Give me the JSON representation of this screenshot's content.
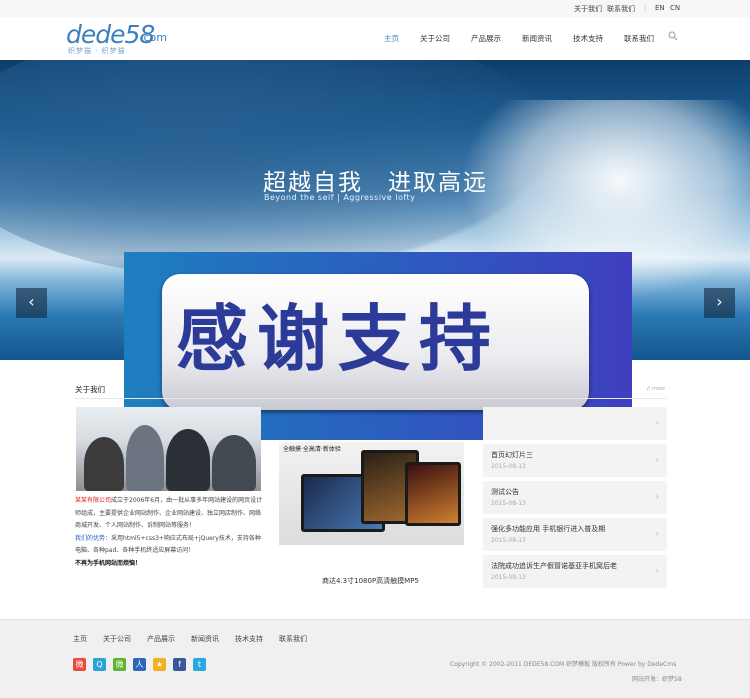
{
  "topbar": {
    "links": [
      "关于我们",
      "联系我们"
    ],
    "sep": "|",
    "lang_en": "EN",
    "lang_cn": "CN"
  },
  "logo": {
    "main": "dede58",
    "com": ".com",
    "sub": "织梦猫 · 织梦猫"
  },
  "nav": {
    "items": [
      "主页",
      "关于公司",
      "产品展示",
      "新闻资讯",
      "技术支持",
      "联系我们"
    ],
    "active": 0
  },
  "hero": {
    "title": "超越自我　进取高远",
    "subtitle": "Beyond the self | Aggressive lofty",
    "prev": "‹",
    "next": "›"
  },
  "overlay": {
    "text": "感谢支持"
  },
  "about": {
    "heading": "关于我们",
    "more": "// more",
    "company": "某某有限公司",
    "para1": "成立于2006年6月，由一批从事多年网站建设的网页设计师组成，主要提供企业网站制作、企业网站建设、独立网店制作、网络商城开发、个人网站制作、诉制网站等服务！",
    "adv_label": "我们的优势：",
    "para2": "采用html5+css3+响应式布局+jQuery技术，支持各种电脑、各种pad、各种手机终适应屏幕访问！",
    "bold": "不再为手机网站而烦恼！"
  },
  "product": {
    "tag": "全触摸·全高清·新体验",
    "caption": "商达4.3寸1080P高清触摸MP5"
  },
  "news": [
    {
      "title": "",
      "date": ""
    },
    {
      "title": "首页幻灯片三",
      "date": "2015-08-13"
    },
    {
      "title": "测试公告",
      "date": "2015-08-13"
    },
    {
      "title": "强化多功能应用 手机银行进入普及期",
      "date": "2015-08-13"
    },
    {
      "title": "法院成功追诉生产假冒诺基亚手机窝后老",
      "date": "2015-08-13"
    }
  ],
  "footer": {
    "nav": [
      "主页",
      "关于公司",
      "产品展示",
      "新闻资讯",
      "技术支持",
      "联系我们"
    ],
    "social": [
      {
        "icon": "weibo-icon",
        "color": "#e84b3c",
        "glyph": "微"
      },
      {
        "icon": "qq-weibo-icon",
        "color": "#2aa4d8",
        "glyph": "Q"
      },
      {
        "icon": "wechat-icon",
        "color": "#5cb531",
        "glyph": "微"
      },
      {
        "icon": "renren-icon",
        "color": "#2c67b8",
        "glyph": "人"
      },
      {
        "icon": "star-icon",
        "color": "#f2b11c",
        "glyph": "★"
      },
      {
        "icon": "facebook-icon",
        "color": "#3b5998",
        "glyph": "f"
      },
      {
        "icon": "twitter-icon",
        "color": "#2aa9e0",
        "glyph": "t"
      }
    ],
    "copyright": "Copyright © 2002-2011 DEDE58.COM 织梦模板 版权所有 Power by DedeCms",
    "credit": "网站开发：织梦58"
  }
}
